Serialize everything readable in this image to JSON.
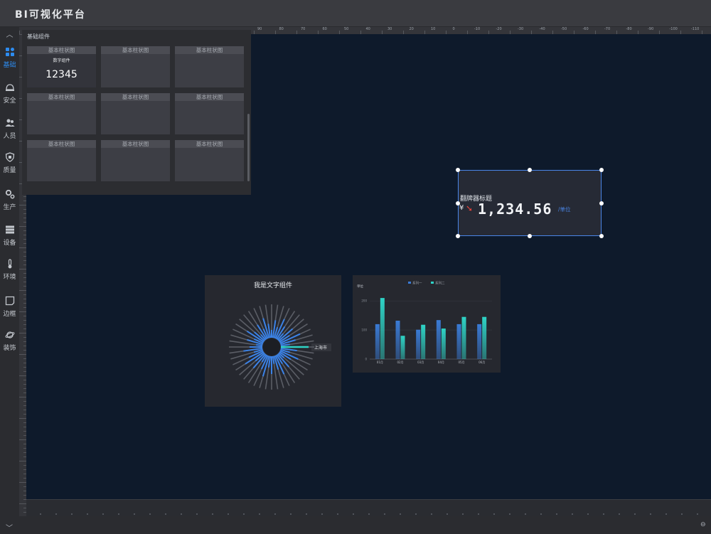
{
  "app": {
    "title": "BI可视化平台"
  },
  "sidebar": {
    "items": [
      {
        "label": "基础",
        "icon": "grid-icon",
        "active": true
      },
      {
        "label": "安全",
        "icon": "helmet-icon"
      },
      {
        "label": "人员",
        "icon": "people-icon"
      },
      {
        "label": "质量",
        "icon": "shield-icon"
      },
      {
        "label": "生产",
        "icon": "gears-icon"
      },
      {
        "label": "设备",
        "icon": "server-icon"
      },
      {
        "label": "环境",
        "icon": "thermometer-icon"
      },
      {
        "label": "边框",
        "icon": "frame-icon"
      },
      {
        "label": "装饰",
        "icon": "planet-icon"
      }
    ]
  },
  "ruler": {
    "top_labels": [
      "90",
      "80",
      "70",
      "60",
      "50",
      "40",
      "30",
      "20",
      "10",
      "0",
      "-10",
      "-20",
      "-30",
      "-40",
      "-50",
      "-60",
      "-70",
      "-80",
      "-90",
      "-100",
      "-110"
    ]
  },
  "panel": {
    "title": "基础组件",
    "cells": [
      "基本柱状图",
      "基本柱状图",
      "基本柱状图",
      "基本柱状图",
      "基本柱状图",
      "基本柱状图",
      "基本柱状图",
      "基本柱状图",
      "基本柱状图"
    ],
    "number_component": {
      "label": "数字组件",
      "value": "12345"
    }
  },
  "flip": {
    "title": "翻牌器标题",
    "prefix": "¥",
    "digits": [
      "1",
      ",",
      "2",
      "3",
      "4",
      ".",
      "5",
      "6"
    ],
    "unit": "/单位",
    "trend": "down",
    "colors": {
      "arrow": "#e8453c",
      "unit": "#4a86e8",
      "border": "#4a86e8"
    }
  },
  "radial": {
    "title": "我是文字组件",
    "highlight_label": "上海市"
  },
  "chart_data": {
    "type": "bar",
    "categories": [
      "01月",
      "02月",
      "03月",
      "04月",
      "05月",
      "06月"
    ],
    "series": [
      {
        "name": "系列一",
        "values": [
          120,
          132,
          101,
          134,
          120,
          120
        ],
        "color": "#3a7bd5"
      },
      {
        "name": "系列二",
        "values": [
          210,
          80,
          118,
          105,
          145,
          145
        ],
        "color": "#2ed3c6"
      }
    ],
    "ylabel": "单位",
    "yticks": [
      "0",
      "100",
      "200"
    ],
    "ylim": [
      0,
      220
    ],
    "legend": "top",
    "grid": true
  }
}
